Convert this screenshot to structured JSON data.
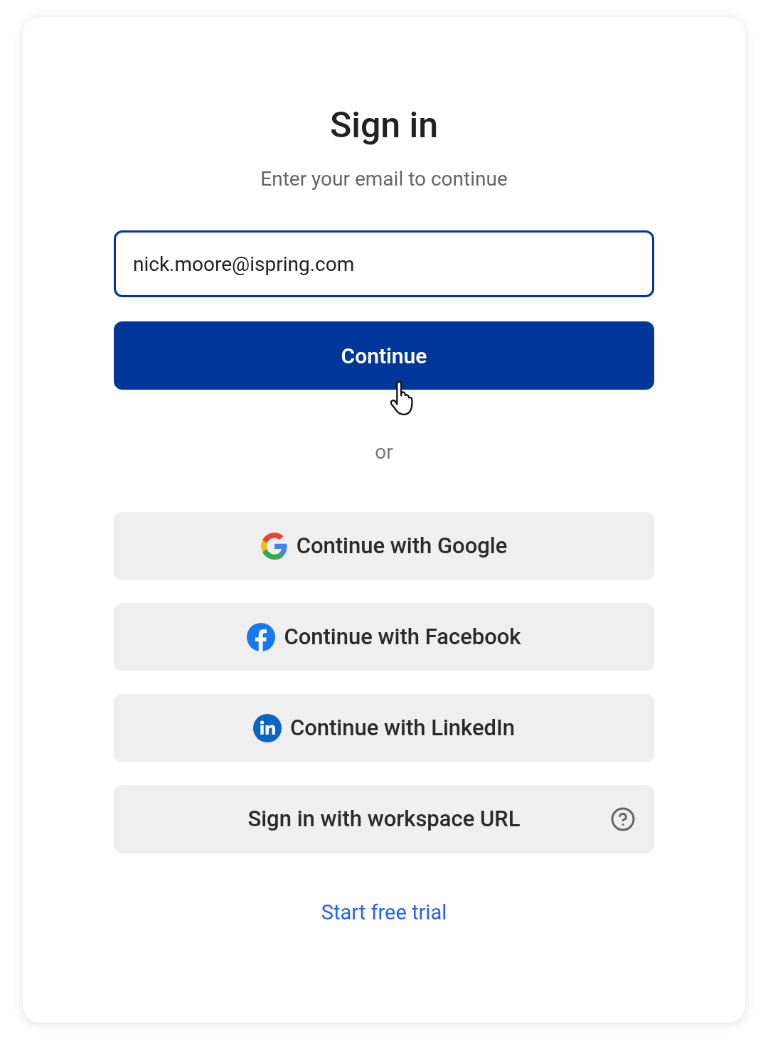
{
  "title": "Sign in",
  "subtitle": "Enter your email to continue",
  "email_field": {
    "value": "nick.moore@ispring.com",
    "focused": true
  },
  "continue_button": {
    "label": "Continue",
    "hovered": true
  },
  "divider_text": "or",
  "providers": [
    {
      "kind": "google",
      "label": "Continue with Google"
    },
    {
      "kind": "facebook",
      "label": "Continue with Facebook"
    },
    {
      "kind": "linkedin",
      "label": "Continue with LinkedIn"
    },
    {
      "kind": "workspace",
      "label": "Sign in with workspace URL"
    }
  ],
  "trial_link": "Start free trial"
}
